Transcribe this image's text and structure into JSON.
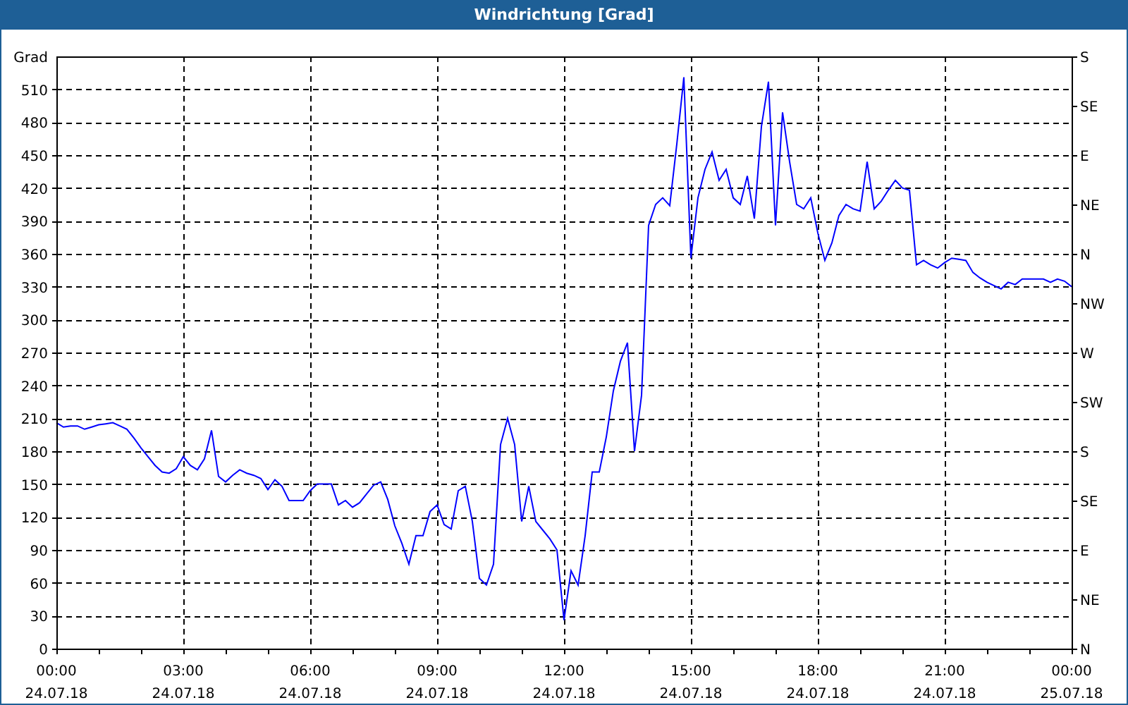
{
  "window": {
    "title": "Windrichtung [Grad]"
  },
  "chart": {
    "chart_data": {
      "type": "line",
      "ylabel": "Grad",
      "categories": [
        "00:00 24.07.18",
        null,
        null,
        null,
        null,
        null,
        null,
        null,
        null,
        null,
        null,
        null,
        null,
        null,
        null,
        null,
        null,
        null,
        "03:00 24.07.18",
        null,
        null,
        null,
        null,
        null,
        null,
        null,
        null,
        null,
        null,
        null,
        null,
        null,
        null,
        null,
        null,
        null,
        "06:00 24.07.18",
        null,
        null,
        null,
        null,
        null,
        null,
        null,
        null,
        null,
        null,
        null,
        null,
        null,
        null,
        null,
        null,
        null,
        "09:00 24.07.18",
        null,
        null,
        null,
        null,
        null,
        null,
        null,
        null,
        null,
        null,
        null,
        null,
        null,
        null,
        null,
        null,
        null,
        "12:00 24.07.18",
        null,
        null,
        null,
        null,
        null,
        null,
        null,
        null,
        null,
        null,
        null,
        null,
        null,
        null,
        null,
        null,
        null,
        "15:00 24.07.18",
        null,
        null,
        null,
        null,
        null,
        null,
        null,
        null,
        null,
        null,
        null,
        null,
        null,
        null,
        null,
        null,
        null,
        "18:00 24.07.18",
        null,
        null,
        null,
        null,
        null,
        null,
        null,
        null,
        null,
        null,
        null,
        null,
        null,
        null,
        null,
        null,
        null,
        "21:00 24.07.18",
        null,
        null,
        null,
        null,
        null,
        null,
        null,
        null,
        null,
        null,
        null,
        null,
        null,
        null,
        null,
        null,
        null,
        "00:00 25.07.18"
      ],
      "series": [
        {
          "color": "#0000ff",
          "values": [
            206,
            202,
            203,
            203,
            200,
            202,
            204,
            205,
            206,
            203,
            200,
            192,
            183,
            175,
            167,
            161,
            160,
            164,
            175,
            167,
            163,
            173,
            199,
            157,
            152,
            158,
            163,
            160,
            158,
            155,
            145,
            154,
            148,
            135,
            135,
            135,
            144,
            150,
            150,
            150,
            131,
            135,
            129,
            133,
            141,
            149,
            152,
            136,
            112,
            96,
            77,
            103,
            103,
            125,
            131,
            113,
            109,
            144,
            148,
            116,
            64,
            58,
            77,
            186,
            210,
            186,
            116,
            148,
            116,
            108,
            100,
            90,
            26,
            71,
            58,
            103,
            161,
            161,
            193,
            235,
            262,
            279,
            180,
            231,
            386,
            405,
            411,
            404,
            460,
            521,
            356,
            411,
            437,
            453,
            427,
            437,
            411,
            405,
            431,
            392,
            476,
            517,
            386,
            489,
            444,
            405,
            401,
            411,
            379,
            354,
            370,
            395,
            405,
            401,
            399,
            444,
            401,
            408,
            418,
            427,
            420,
            418,
            350,
            354,
            350,
            347,
            352,
            356,
            355,
            354,
            343,
            338,
            334,
            331,
            328,
            334,
            332,
            337,
            337,
            337,
            337,
            334,
            337,
            335,
            330
          ]
        }
      ],
      "ylim": [
        0,
        540
      ],
      "grid": true,
      "yticks": [
        0,
        30,
        60,
        90,
        120,
        150,
        180,
        210,
        240,
        270,
        300,
        330,
        360,
        390,
        420,
        450,
        480,
        510
      ]
    },
    "compass_labels": [
      "S",
      "SE",
      "E",
      "NE",
      "N",
      "NW",
      "W",
      "SW",
      "S",
      "SE",
      "E",
      "NE",
      "N"
    ]
  }
}
